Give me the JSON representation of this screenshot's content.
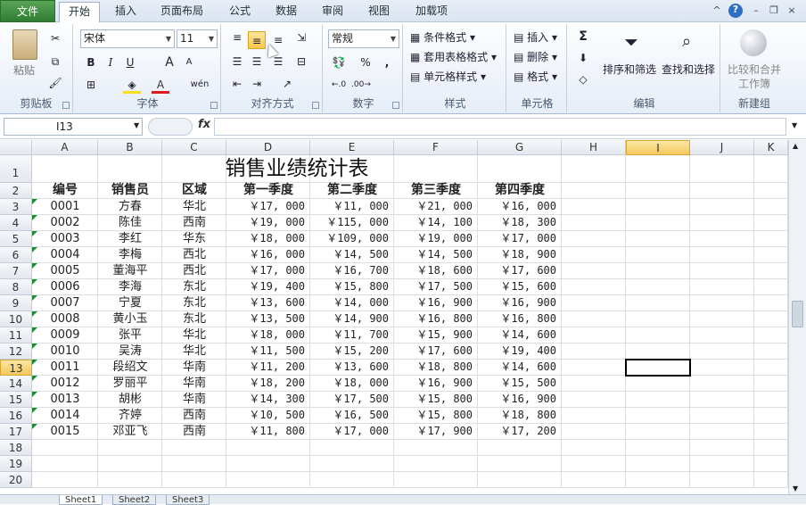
{
  "tabs": [
    "文件",
    "开始",
    "插入",
    "页面布局",
    "公式",
    "数据",
    "审阅",
    "视图",
    "加载项"
  ],
  "window_controls": {
    "minimize_ribbon": "^",
    "help": "?",
    "minimize": "–",
    "restore": "❐",
    "close": "×"
  },
  "ribbon": {
    "clipboard": {
      "paste": "粘贴",
      "label": "剪贴板"
    },
    "font": {
      "name": "宋体",
      "size": "11",
      "bold": "B",
      "italic": "I",
      "underline": "U",
      "grow": "A",
      "shrink": "A",
      "label": "字体",
      "font_color_letter": "A",
      "wen": "wén"
    },
    "alignment": {
      "label": "对齐方式"
    },
    "number": {
      "format": "常规",
      "percent": "%",
      "comma": ",",
      "label": "数字"
    },
    "styles": {
      "conditional": "条件格式",
      "table": "套用表格格式",
      "cell": "单元格样式",
      "label": "样式"
    },
    "cells": {
      "insert": "插入",
      "delete": "删除",
      "format": "格式",
      "label": "单元格"
    },
    "editing": {
      "sum": "Σ",
      "sort": "排序和筛选",
      "find": "查找和选择",
      "label": "编辑"
    },
    "merge": {
      "compare": "比较和合并",
      "compare2": "工作簿",
      "label": "新建组"
    }
  },
  "formula_bar": {
    "name_box": "I13",
    "fx": "fx",
    "value": ""
  },
  "columns": [
    "A",
    "B",
    "C",
    "D",
    "E",
    "F",
    "G",
    "H",
    "I",
    "J",
    "K"
  ],
  "rows": [
    "1",
    "2",
    "3",
    "4",
    "5",
    "6",
    "7",
    "8",
    "9",
    "10",
    "11",
    "12",
    "13",
    "14",
    "15",
    "16",
    "17",
    "18",
    "19",
    "20"
  ],
  "sheet": {
    "title": "销售业绩统计表",
    "headers": [
      "编号",
      "销售员",
      "区域",
      "第一季度",
      "第二季度",
      "第三季度",
      "第四季度"
    ],
    "data": [
      [
        "0001",
        "方春",
        "华北",
        "￥17, 000",
        "￥11, 000",
        "￥21, 000",
        "￥16, 000"
      ],
      [
        "0002",
        "陈佳",
        "西南",
        "￥19, 000",
        "￥115, 000",
        "￥14, 100",
        "￥18, 300"
      ],
      [
        "0003",
        "李红",
        "华东",
        "￥18, 000",
        "￥109, 000",
        "￥19, 000",
        "￥17, 000"
      ],
      [
        "0004",
        "李梅",
        "西北",
        "￥16, 000",
        "￥14, 500",
        "￥14, 500",
        "￥18, 900"
      ],
      [
        "0005",
        "董海平",
        "西北",
        "￥17, 000",
        "￥16, 700",
        "￥18, 600",
        "￥17, 600"
      ],
      [
        "0006",
        "李海",
        "东北",
        "￥19, 400",
        "￥15, 800",
        "￥17, 500",
        "￥15, 600"
      ],
      [
        "0007",
        "宁夏",
        "东北",
        "￥13, 600",
        "￥14, 000",
        "￥16, 900",
        "￥16, 900"
      ],
      [
        "0008",
        "黄小玉",
        "东北",
        "￥13, 500",
        "￥14, 900",
        "￥16, 800",
        "￥16, 800"
      ],
      [
        "0009",
        "张平",
        "华北",
        "￥18, 000",
        "￥11, 700",
        "￥15, 900",
        "￥14, 600"
      ],
      [
        "0010",
        "吴涛",
        "华北",
        "￥11, 500",
        "￥15, 200",
        "￥17, 600",
        "￥19, 400"
      ],
      [
        "0011",
        "段绍文",
        "华南",
        "￥11, 200",
        "￥13, 600",
        "￥18, 800",
        "￥14, 600"
      ],
      [
        "0012",
        "罗丽平",
        "华南",
        "￥18, 200",
        "￥18, 000",
        "￥16, 900",
        "￥15, 500"
      ],
      [
        "0013",
        "胡彬",
        "华南",
        "￥14, 300",
        "￥17, 500",
        "￥15, 800",
        "￥16, 900"
      ],
      [
        "0014",
        "齐婷",
        "西南",
        "￥10, 500",
        "￥16, 500",
        "￥15, 800",
        "￥18, 800"
      ],
      [
        "0015",
        "邓亚飞",
        "西南",
        "￥11, 800",
        "￥17, 000",
        "￥17, 900",
        "￥17, 200"
      ]
    ]
  },
  "sheet_tabs": [
    "Sheet1",
    "Sheet2",
    "Sheet3"
  ],
  "colors": {
    "accent_file": "#2f7d32",
    "selection": "#f9c74c",
    "error_triangle": "#1f8a34"
  }
}
